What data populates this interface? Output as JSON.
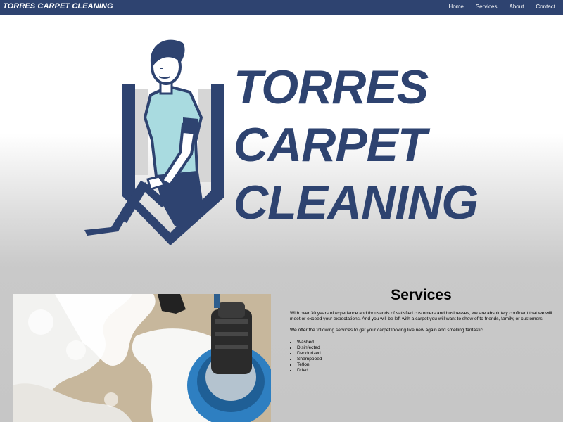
{
  "navbar": {
    "brand": "TORRES CARPET CLEANING",
    "links": [
      "Home",
      "Services",
      "About",
      "Contact"
    ]
  },
  "hero": {
    "logo_lines": [
      "TORRES",
      "CARPET",
      "CLEANING"
    ],
    "logo_icon": "carpet-cleaner-man-icon"
  },
  "photo": {
    "icon": "floor-scrubber-foam-photo"
  },
  "services": {
    "title": "Services",
    "paragraph1": "With over 30 years of experience and thousands of satisfied customers and businesses, we are absolutely confident that we will meet or exceed your expectations. And you will be left with a carpet you will want to show of to friends, family, or customers.",
    "paragraph2": "We offer the following services to get your carpet looking like new again and smelling fantastic.",
    "items": [
      "Washed",
      "Disinfected",
      "Deodorized",
      "Shampooed",
      "Teflon",
      "Dried"
    ]
  },
  "colors": {
    "navbar": "#2e4370",
    "logo": "#2e4370",
    "shirt": "#a9dbe0",
    "background_bottom": "#c6c6c6"
  }
}
